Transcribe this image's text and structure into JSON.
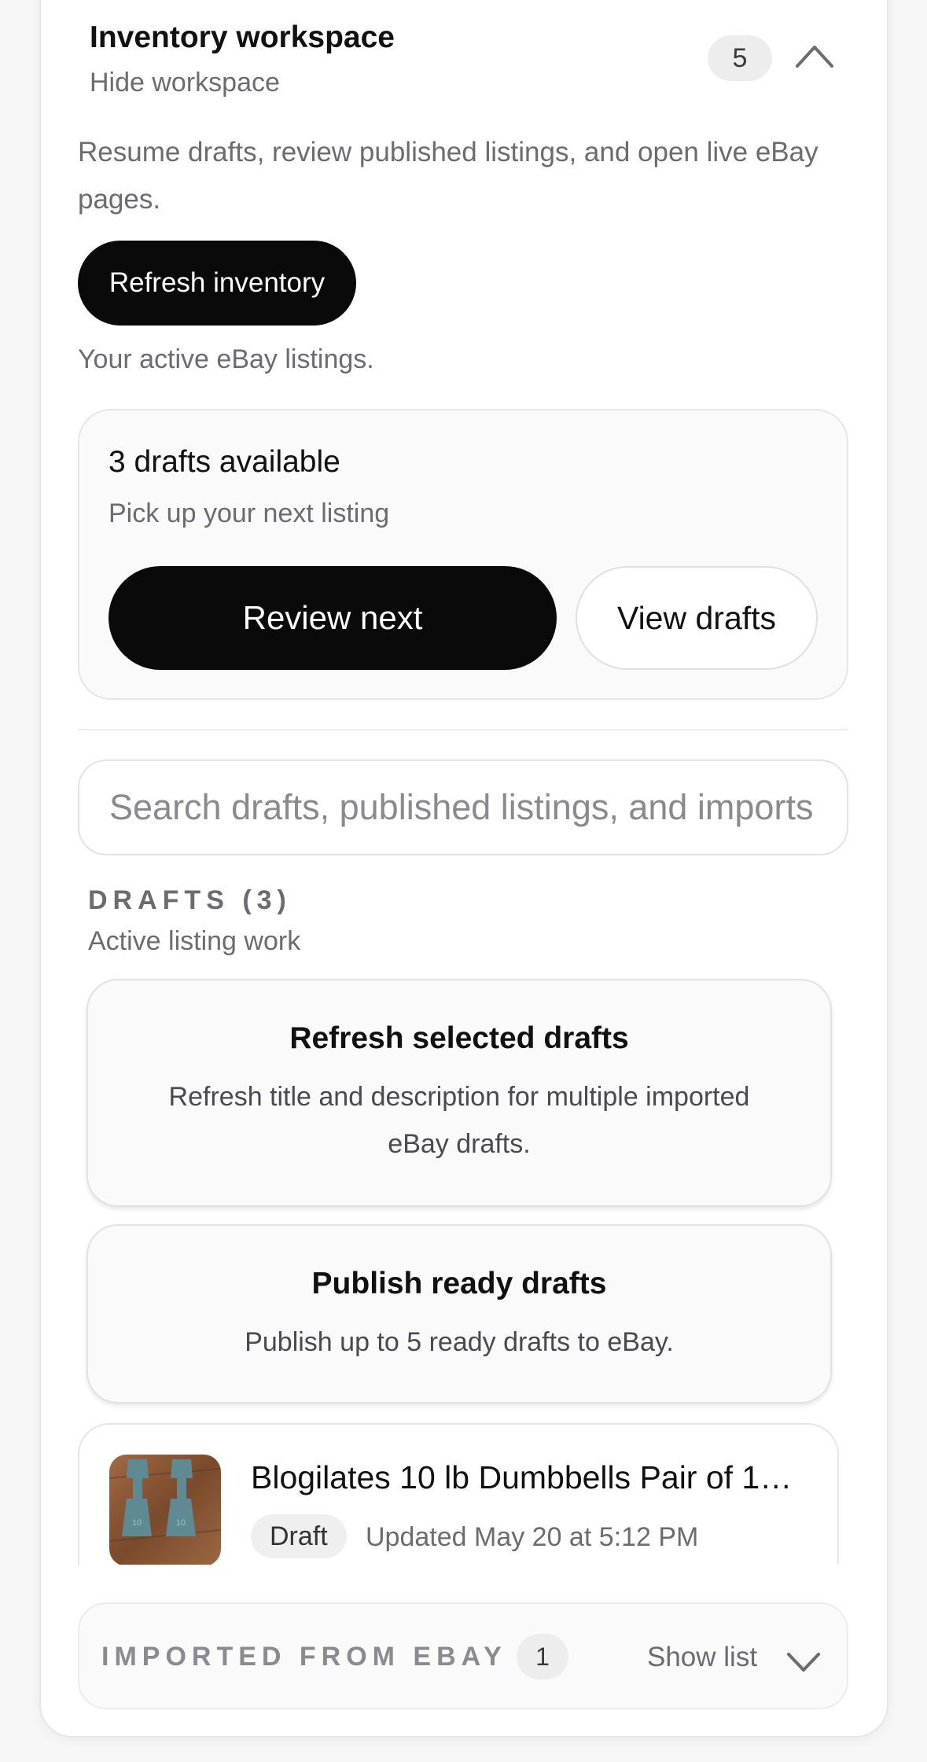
{
  "workspace": {
    "title": "Inventory workspace",
    "hide_label": "Hide workspace",
    "count": "5",
    "description": "Resume drafts, review published listings, and open live eBay pages.",
    "refresh_label": "Refresh inventory",
    "active_note": "Your active eBay listings."
  },
  "drafts_summary": {
    "title": "3 drafts available",
    "subtitle": "Pick up your next listing",
    "review_label": "Review next",
    "view_label": "View drafts"
  },
  "search": {
    "placeholder": "Search drafts, published listings, and imports"
  },
  "drafts_section": {
    "label": "DRAFTS (3)",
    "subtitle": "Active listing work",
    "actions": [
      {
        "title": "Refresh selected drafts",
        "description": "Refresh title and description for multiple imported eBay drafts."
      },
      {
        "title": "Publish ready drafts",
        "description": "Publish up to 5 ready drafts to eBay."
      }
    ],
    "items": [
      {
        "title": "Blogilates 10 lb Dumbbells Pair of 1…",
        "status": "Draft",
        "updated": "Updated May 20 at 5:12 PM",
        "thumb_label": "10"
      }
    ]
  },
  "imported": {
    "label": "IMPORTED FROM EBAY",
    "count": "1",
    "toggle_label": "Show list"
  },
  "colors": {
    "primary": "#0a0a0a",
    "muted_text": "#6b6b70",
    "badge_bg": "#ededee",
    "dumbbell": "#5f8a94",
    "wood": "#8a5a3a"
  }
}
